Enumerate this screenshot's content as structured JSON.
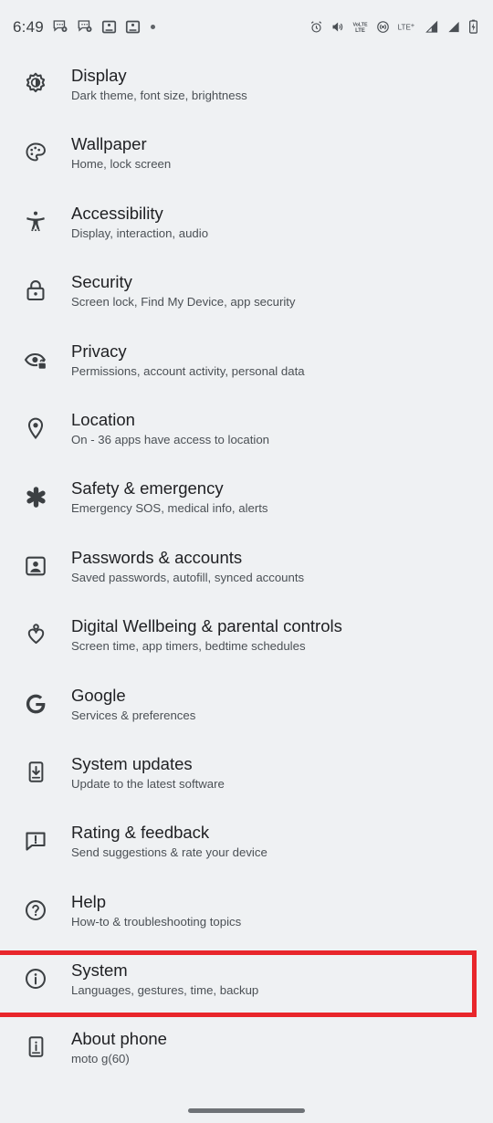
{
  "status_bar": {
    "clock": "6:49",
    "left_icons": [
      "message-badge-icon",
      "message-badge-icon-2",
      "screenshot-icon",
      "screenshot-icon-2",
      "notification-dot-icon"
    ],
    "right_icons": [
      "alarm-icon",
      "vibrate-icon",
      "volte-icon",
      "wifi-calling-icon",
      "lte-plus-icon",
      "signal-bars-sim1-icon",
      "signal-bars-sim2-icon",
      "battery-charging-icon"
    ],
    "volte_label": "VoLTE",
    "lte_label": "LTE+"
  },
  "theme": {
    "background": "#eff1f3",
    "title_color": "#202124",
    "subtitle_color": "#4b5055",
    "icon_color": "#3c4043",
    "highlight_color": "#e8262b"
  },
  "settings": {
    "items": [
      {
        "icon": "brightness-icon",
        "title": "Display",
        "subtitle": "Dark theme, font size, brightness",
        "highlighted": false
      },
      {
        "icon": "palette-icon",
        "title": "Wallpaper",
        "subtitle": "Home, lock screen",
        "highlighted": false
      },
      {
        "icon": "accessibility-icon",
        "title": "Accessibility",
        "subtitle": "Display, interaction, audio",
        "highlighted": false
      },
      {
        "icon": "lock-icon",
        "title": "Security",
        "subtitle": "Screen lock, Find My Device, app security",
        "highlighted": false
      },
      {
        "icon": "eye-lock-icon",
        "title": "Privacy",
        "subtitle": "Permissions, account activity, personal data",
        "highlighted": false
      },
      {
        "icon": "location-pin-icon",
        "title": "Location",
        "subtitle": "On - 36 apps have access to location",
        "highlighted": false
      },
      {
        "icon": "emergency-star-icon",
        "title": "Safety & emergency",
        "subtitle": "Emergency SOS, medical info, alerts",
        "highlighted": false
      },
      {
        "icon": "account-box-icon",
        "title": "Passwords & accounts",
        "subtitle": "Saved passwords, autofill, synced accounts",
        "highlighted": false
      },
      {
        "icon": "wellbeing-heart-icon",
        "title": "Digital Wellbeing & parental controls",
        "subtitle": "Screen time, app timers, bedtime schedules",
        "highlighted": false
      },
      {
        "icon": "google-g-icon",
        "title": "Google",
        "subtitle": "Services & preferences",
        "highlighted": false
      },
      {
        "icon": "system-update-icon",
        "title": "System updates",
        "subtitle": "Update to the latest software",
        "highlighted": false
      },
      {
        "icon": "feedback-icon",
        "title": "Rating & feedback",
        "subtitle": "Send suggestions & rate your device",
        "highlighted": false
      },
      {
        "icon": "help-circle-icon",
        "title": "Help",
        "subtitle": "How-to & troubleshooting topics",
        "highlighted": false
      },
      {
        "icon": "info-circle-icon",
        "title": "System",
        "subtitle": "Languages, gestures, time, backup",
        "highlighted": true
      },
      {
        "icon": "about-phone-icon",
        "title": "About phone",
        "subtitle": "moto g(60)",
        "highlighted": false
      }
    ]
  },
  "navigation": {
    "gesture_bar": "home-gesture-bar"
  }
}
